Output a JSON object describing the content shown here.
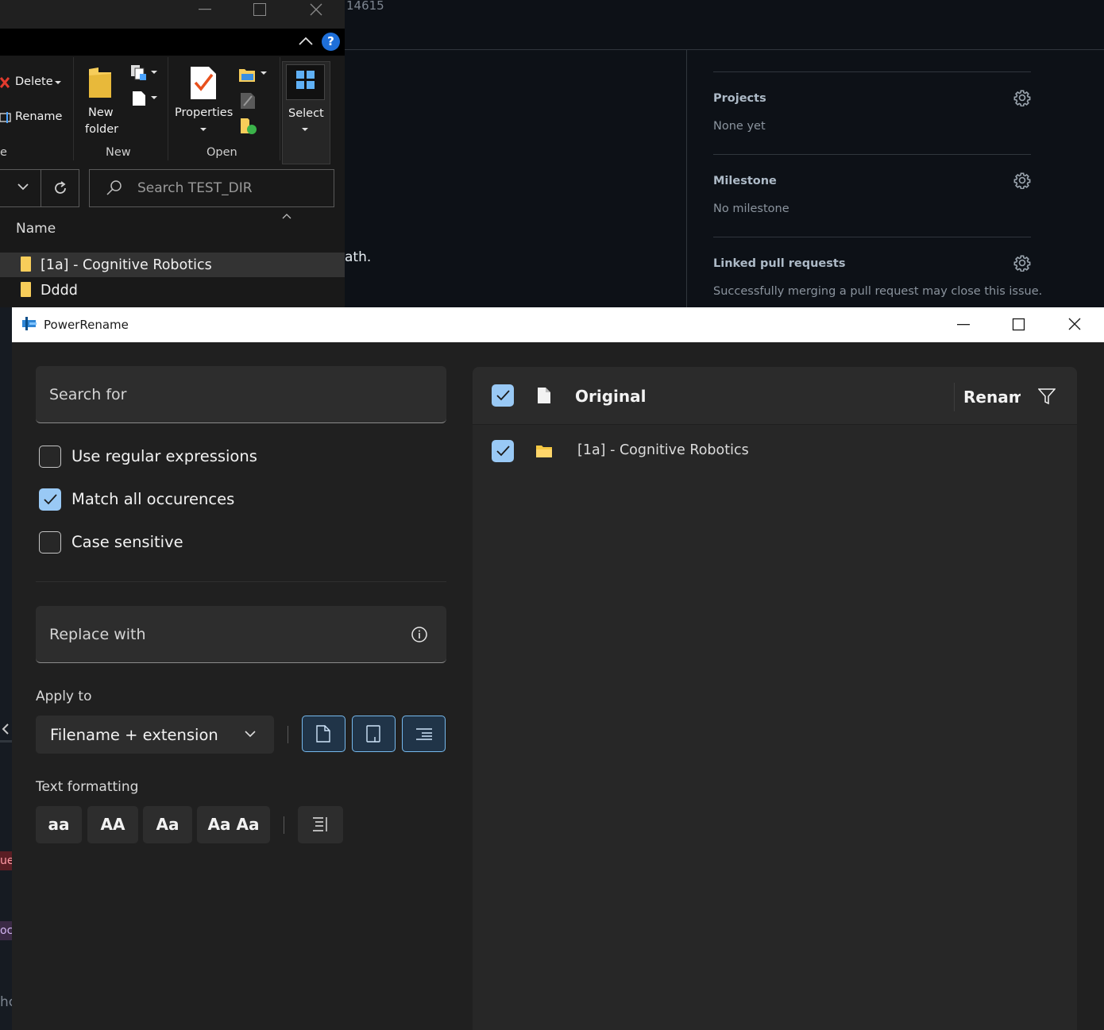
{
  "github": {
    "issue_number": "14615",
    "body_fragment": "ath.",
    "sidebar": [
      {
        "title": "Projects",
        "value": "None yet"
      },
      {
        "title": "Milestone",
        "value": "No milestone"
      },
      {
        "title": "Linked pull requests",
        "value": "Successfully merging a pull request may close this issue."
      }
    ]
  },
  "explorer": {
    "ribbon": {
      "delete_label": "Delete",
      "rename_label": "Rename",
      "organize_group_fragment": "e",
      "new_folder_label_line1": "New",
      "new_folder_label_line2": "folder",
      "new_group": "New",
      "properties_label": "Properties",
      "open_group": "Open",
      "select_label": "Select"
    },
    "search_placeholder": "Search TEST_DIR",
    "column_name": "Name",
    "files": [
      "[1a] - Cognitive Robotics",
      "Dddd"
    ]
  },
  "left_strip": {
    "fragment1": "ue",
    "fragment2": "oc",
    "fragment3": "hc"
  },
  "powerrename": {
    "title": "PowerRename",
    "search_placeholder": "Search for",
    "options": [
      {
        "label": "Use regular expressions",
        "checked": false
      },
      {
        "label": "Match all occurences",
        "checked": true
      },
      {
        "label": "Case sensitive",
        "checked": false
      }
    ],
    "replace_placeholder": "Replace with",
    "apply_to_label": "Apply to",
    "apply_to_value": "Filename + extension",
    "text_formatting_label": "Text formatting",
    "format_buttons": [
      "aa",
      "AA",
      "Aa",
      "Aa Aa"
    ],
    "table": {
      "col_original": "Original",
      "col_rename": "Rename",
      "rows": [
        {
          "checked": true,
          "original": "[1a] - Cognitive Robotics",
          "rename": ""
        }
      ]
    },
    "accent": "#99c9f5"
  }
}
